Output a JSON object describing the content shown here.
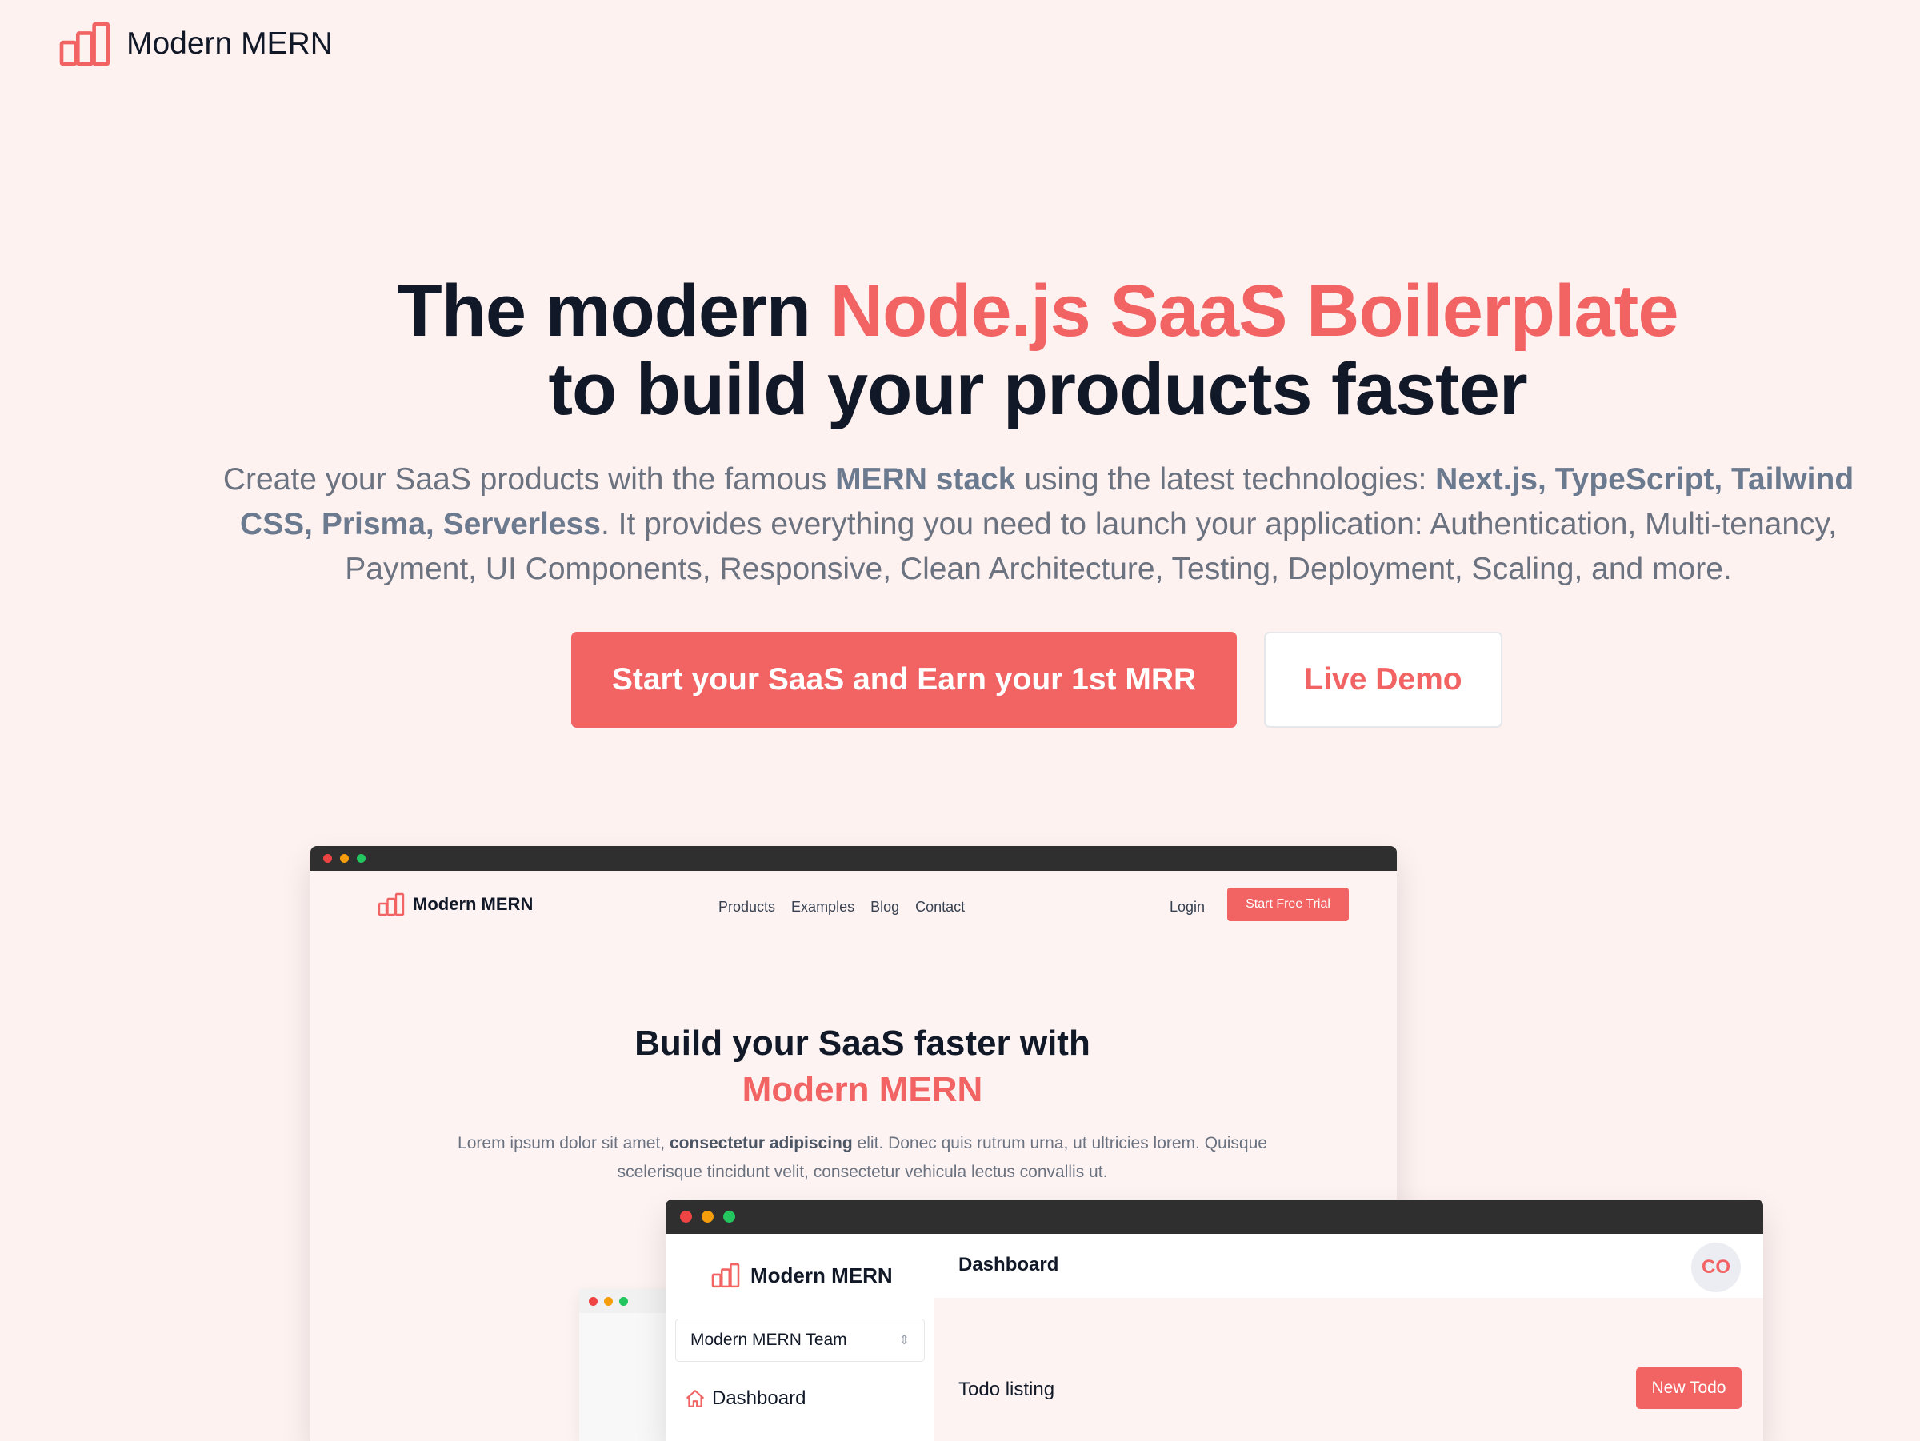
{
  "header": {
    "brand": "Modern MERN"
  },
  "hero": {
    "title_part1": "The modern ",
    "title_accent": "Node.js SaaS Boilerplate",
    "title_part2": "to build your products faster",
    "desc_1": "Create your SaaS products with the famous ",
    "desc_b1": "MERN stack",
    "desc_2": " using the latest technologies: ",
    "desc_b2": "Next.js, TypeScript, Tailwind CSS, Prisma, Serverless",
    "desc_3": ". It provides everything you need to launch your application: Authentication, Multi-tenancy, Payment, UI Components, Responsive, Clean Architecture, Testing, Deployment, Scaling, and more.",
    "primary_cta": "Start your SaaS and Earn your 1st MRR",
    "secondary_cta": "Live Demo"
  },
  "landing_mock": {
    "brand": "Modern MERN",
    "nav": [
      "Products",
      "Examples",
      "Blog",
      "Contact"
    ],
    "login": "Login",
    "cta": "Start Free Trial",
    "title_line1": "Build your SaaS faster with",
    "title_accent": "Modern MERN",
    "desc_1": "Lorem ipsum dolor sit amet, ",
    "desc_b": "consectetur adipiscing",
    "desc_2": " elit. Donec quis rutrum urna, ut ultricies lorem. Quisque scelerisque tincidunt velit, consectetur vehicula lectus convallis ut."
  },
  "dashboard_mock": {
    "brand": "Modern MERN",
    "team": "Modern MERN Team",
    "nav_dashboard": "Dashboard",
    "page_title": "Dashboard",
    "avatar": "CO",
    "section_title": "Todo listing",
    "new_button": "New Todo"
  },
  "colors": {
    "accent": "#f26464",
    "background": "#fef2f1",
    "text": "#111827"
  }
}
